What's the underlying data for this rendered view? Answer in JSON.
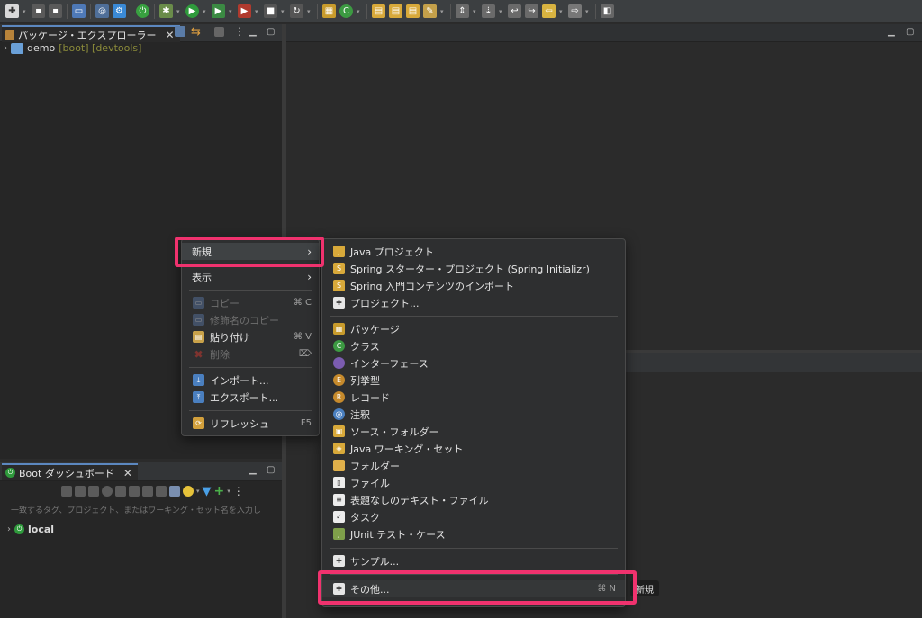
{
  "toolbar": {
    "icons": [
      "new-icon",
      "save-icon",
      "save-all-icon",
      "print-icon",
      "debug-config-icon",
      "settings-icon",
      "boot-dashboard-icon",
      "debug-icon",
      "run-icon",
      "run-coverage-icon",
      "external-tools-icon",
      "new-package-icon",
      "new-class-icon",
      "open-type-icon",
      "open-resource-icon",
      "search-icon",
      "annotation-icon",
      "next-annotation-icon",
      "back-icon",
      "forward-icon",
      "pin-editor-icon"
    ]
  },
  "package_explorer": {
    "tab_label": "パッケージ・エクスプローラー",
    "project": {
      "name": "demo",
      "decorations": "[boot] [devtools]"
    }
  },
  "boot_dashboard": {
    "tab_label": "Boot ダッシュボード",
    "filter_placeholder": "一致するタグ、プロジェクト、またはワーキング・セット名を入力し",
    "items": [
      {
        "label": "local"
      }
    ]
  },
  "context_menu": {
    "items": [
      {
        "label": "新規",
        "submenu": true
      },
      {
        "label": "表示",
        "submenu": true
      },
      {
        "label": "コピー",
        "shortcut": "⌘ C",
        "disabled": true,
        "icon": "copy-icon"
      },
      {
        "label": "修飾名のコピー",
        "disabled": true,
        "icon": "copy-qualified-icon"
      },
      {
        "label": "貼り付け",
        "shortcut": "⌘ V",
        "icon": "paste-icon"
      },
      {
        "label": "削除",
        "shortcut": "⌦",
        "disabled": true,
        "icon": "delete-icon"
      },
      {
        "label": "インポート...",
        "icon": "import-icon"
      },
      {
        "label": "エクスポート...",
        "icon": "export-icon"
      },
      {
        "label": "リフレッシュ",
        "shortcut": "F5",
        "icon": "refresh-icon"
      }
    ]
  },
  "new_submenu": {
    "items": [
      {
        "label": "Java プロジェクト",
        "icon": "java-project-icon"
      },
      {
        "label": "Spring スターター・プロジェクト (Spring Initializr)",
        "icon": "spring-starter-icon"
      },
      {
        "label": "Spring 入門コンテンツのインポート",
        "icon": "spring-import-icon"
      },
      {
        "label": "プロジェクト...",
        "icon": "project-icon"
      },
      {
        "label": "パッケージ",
        "icon": "package-icon"
      },
      {
        "label": "クラス",
        "icon": "class-icon"
      },
      {
        "label": "インターフェース",
        "icon": "interface-icon"
      },
      {
        "label": "列挙型",
        "icon": "enum-icon"
      },
      {
        "label": "レコード",
        "icon": "record-icon"
      },
      {
        "label": "注釈",
        "icon": "annotation-type-icon"
      },
      {
        "label": "ソース・フォルダー",
        "icon": "source-folder-icon"
      },
      {
        "label": "Java ワーキング・セット",
        "icon": "working-set-icon"
      },
      {
        "label": "フォルダー",
        "icon": "folder-icon"
      },
      {
        "label": "ファイル",
        "icon": "file-icon"
      },
      {
        "label": "表題なしのテキスト・ファイル",
        "icon": "untitled-text-file-icon"
      },
      {
        "label": "タスク",
        "icon": "task-icon"
      },
      {
        "label": "JUnit テスト・ケース",
        "icon": "junit-icon"
      },
      {
        "label": "サンプル...",
        "icon": "example-icon"
      },
      {
        "label": "その他...",
        "shortcut": "⌘ N",
        "icon": "other-wizard-icon"
      }
    ]
  },
  "tooltip": {
    "text": "新規"
  },
  "colors": {
    "highlight": "#f0326e",
    "tab_accent": "#5c88c0",
    "background": "#2b2b2b"
  }
}
